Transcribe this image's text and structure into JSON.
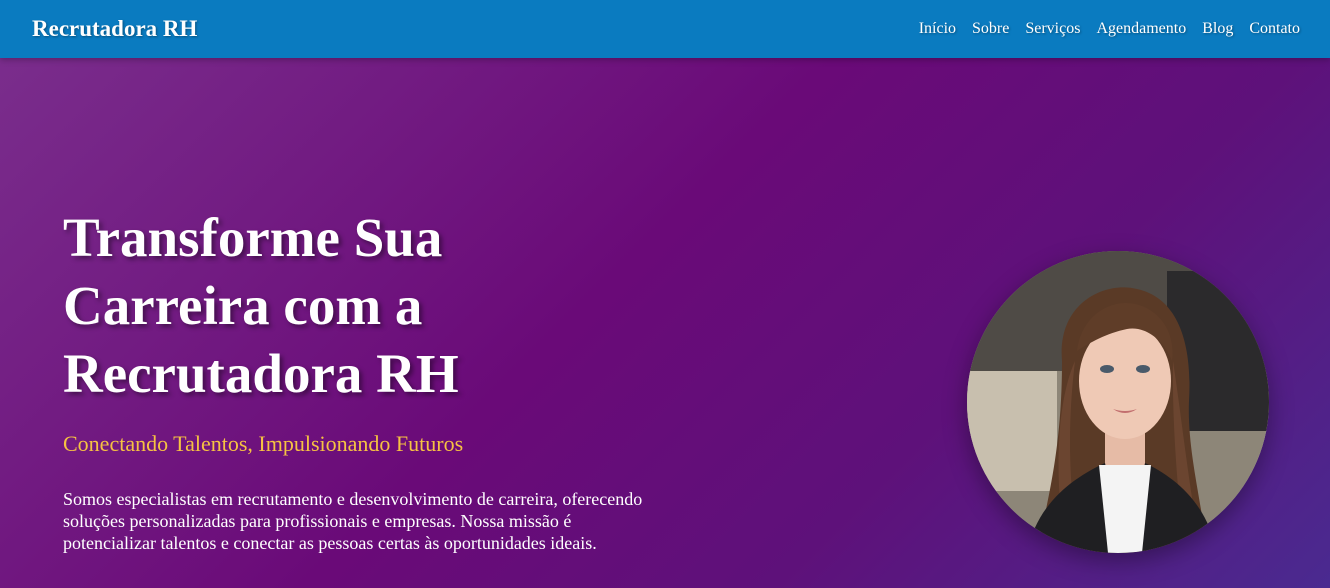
{
  "navbar": {
    "brand": "Recrutadora RH",
    "links": [
      "Início",
      "Sobre",
      "Serviços",
      "Agendamento",
      "Blog",
      "Contato"
    ]
  },
  "hero": {
    "title": "Transforme Sua Carreira com a Recrutadora RH",
    "subtitle": "Conectando Talentos, Impulsionando Futuros",
    "description": "Somos especialistas em recrutamento e desenvolvimento de carreira, oferecendo soluções personalizadas para profissionais e empresas. Nossa missão é potencializar talentos e conectar as pessoas certas às oportunidades ideais."
  },
  "colors": {
    "navbar": "#0a7bc0",
    "hero_gradient_start": "#7a2d8c",
    "hero_gradient_end": "#4a2a90",
    "subtitle": "#f6c242"
  }
}
